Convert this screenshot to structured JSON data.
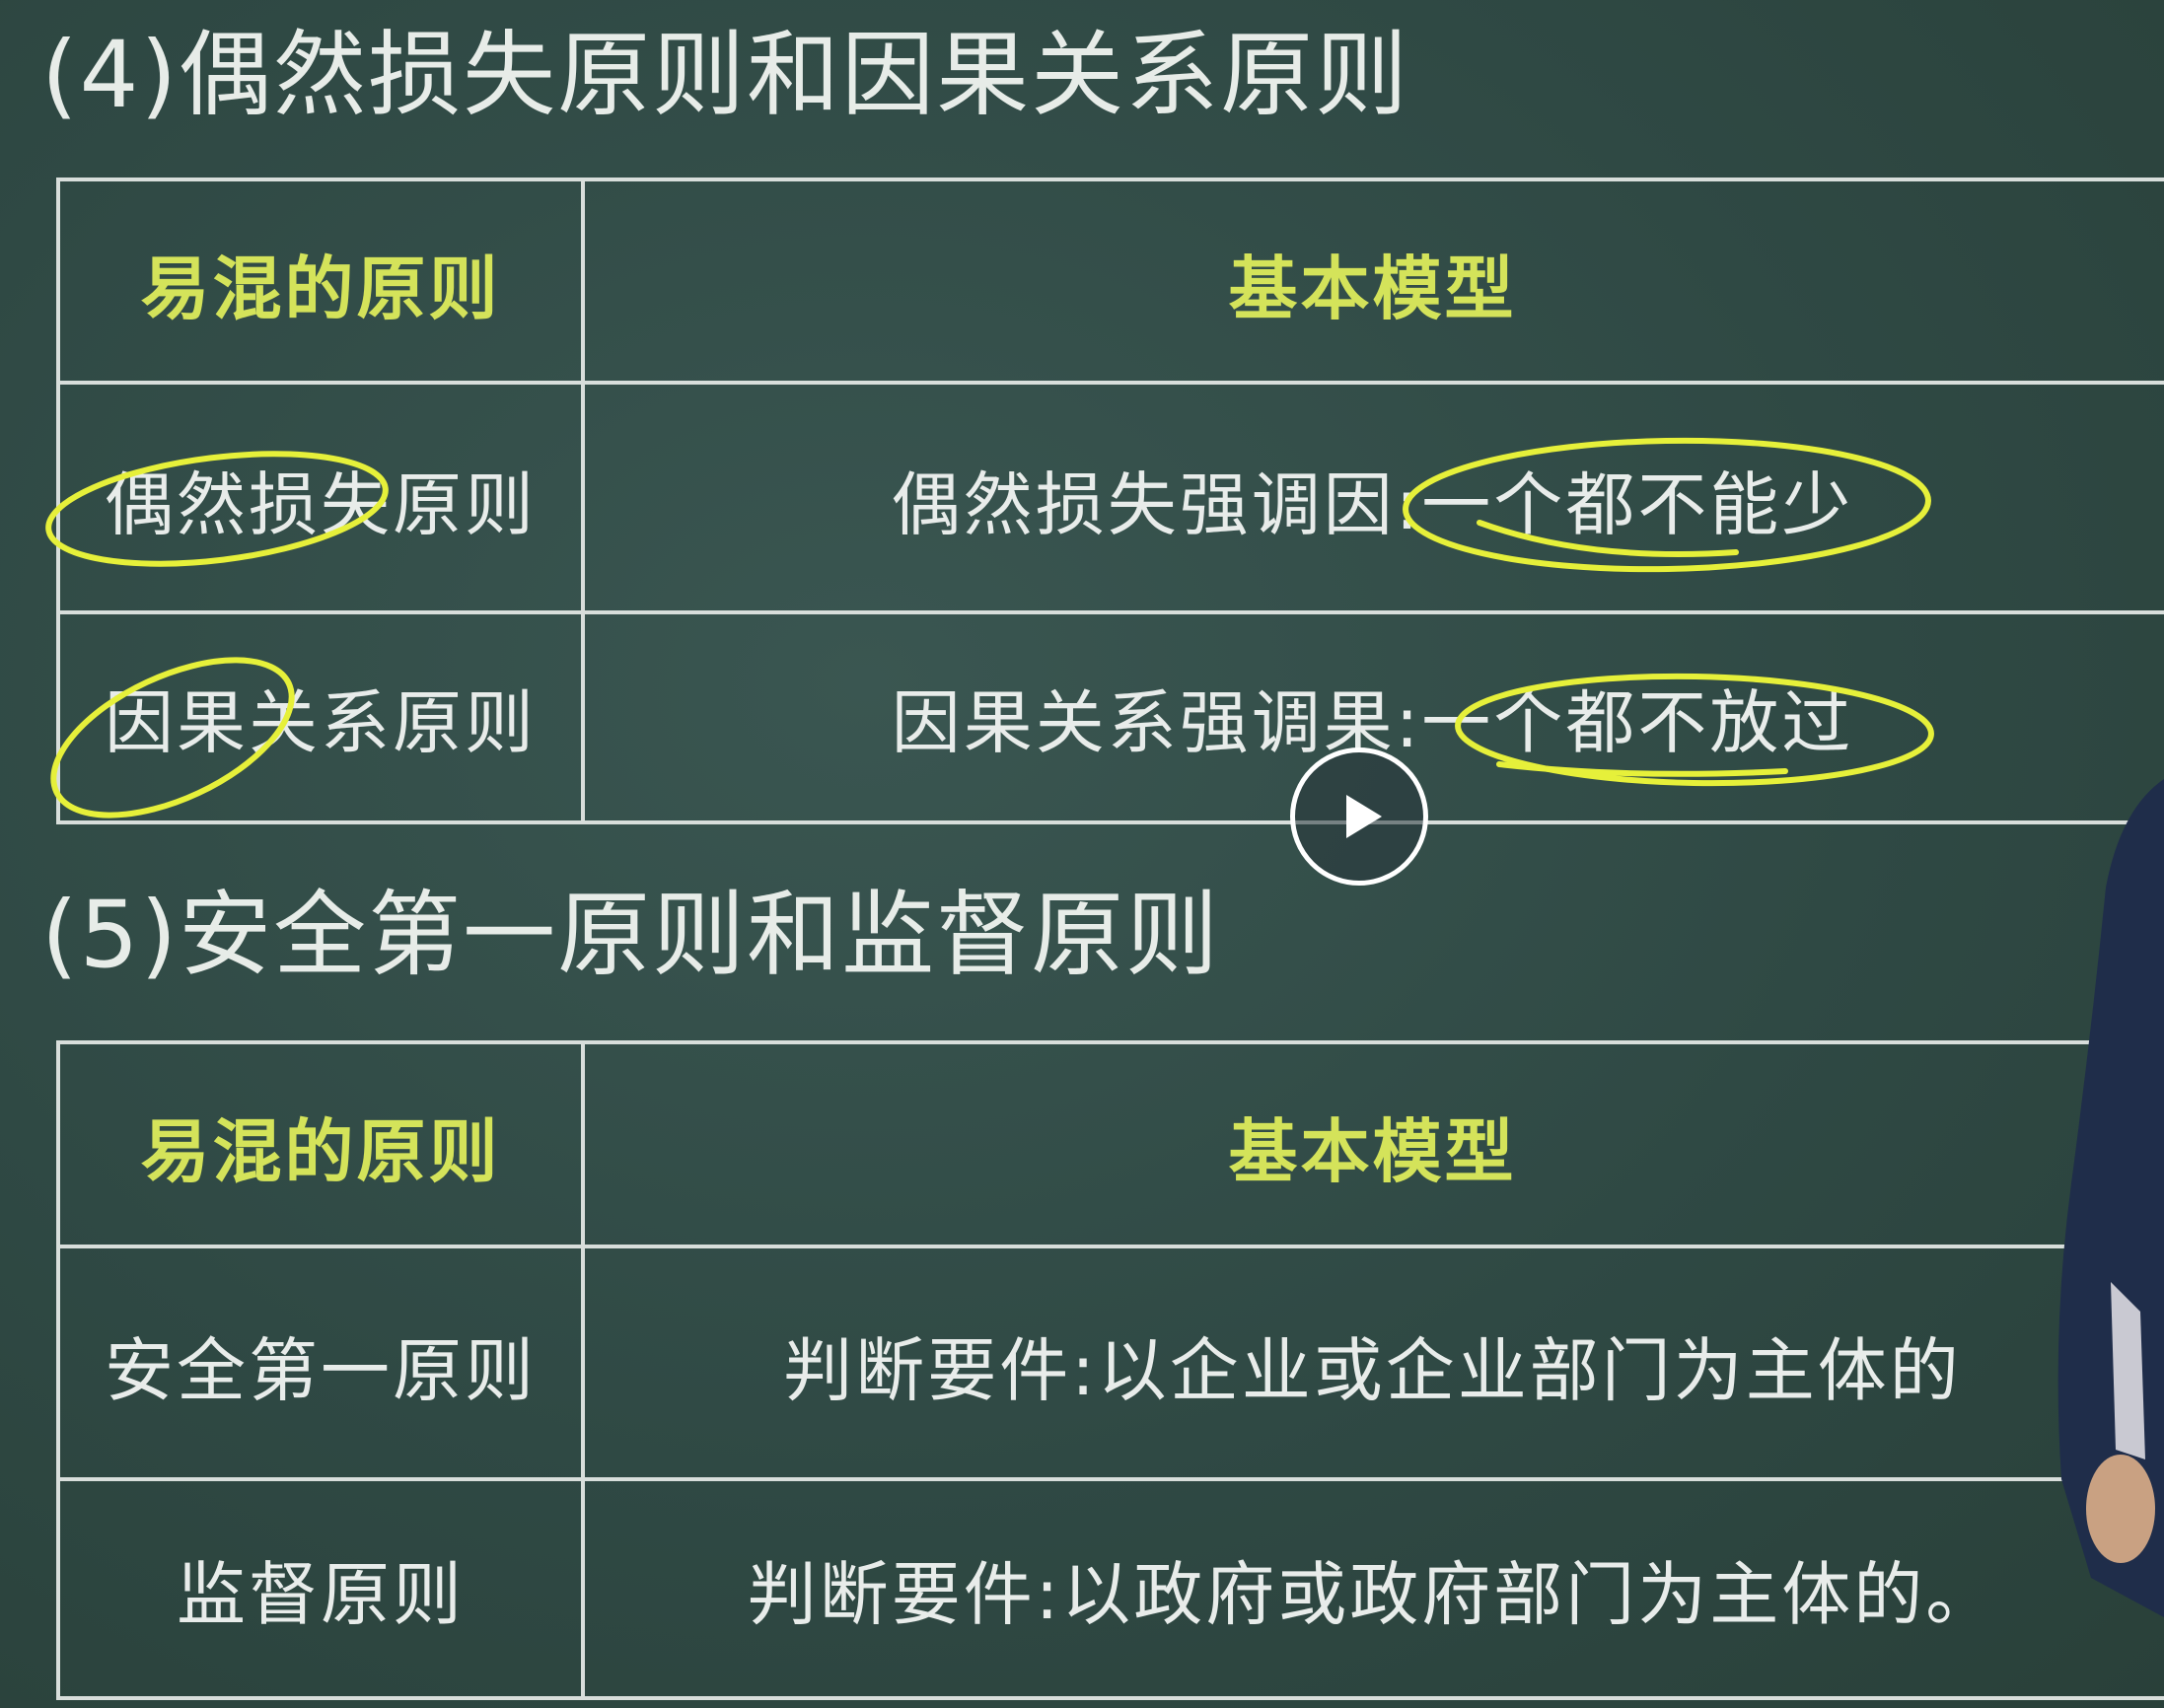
{
  "section4": {
    "heading": "(4)偶然损失原则和因果关系原则",
    "table": {
      "header_left": "易混的原则",
      "header_right": "基本模型",
      "rows": [
        {
          "left": "偶然损失原则",
          "right": "偶然损失强调因:一个都不能少"
        },
        {
          "left": "因果关系原则",
          "right": "因果关系强调果:一个都不放过"
        }
      ]
    }
  },
  "section5": {
    "heading": "(5)安全第一原则和监督原则",
    "table": {
      "header_left": "易混的原则",
      "header_right": "基本模型",
      "rows": [
        {
          "left": "安全第一原则",
          "right": "判断要件:以企业或企业部门为主体的"
        },
        {
          "left": "监督原则",
          "right": "判断要件:以政府或政府部门为主体的。"
        }
      ]
    }
  },
  "player": {
    "play_icon": "play-icon"
  },
  "colors": {
    "board": "#2f4a45",
    "header_text": "#d4e35a",
    "body_text": "#e8ecea",
    "highlight": "#e6f03a"
  }
}
